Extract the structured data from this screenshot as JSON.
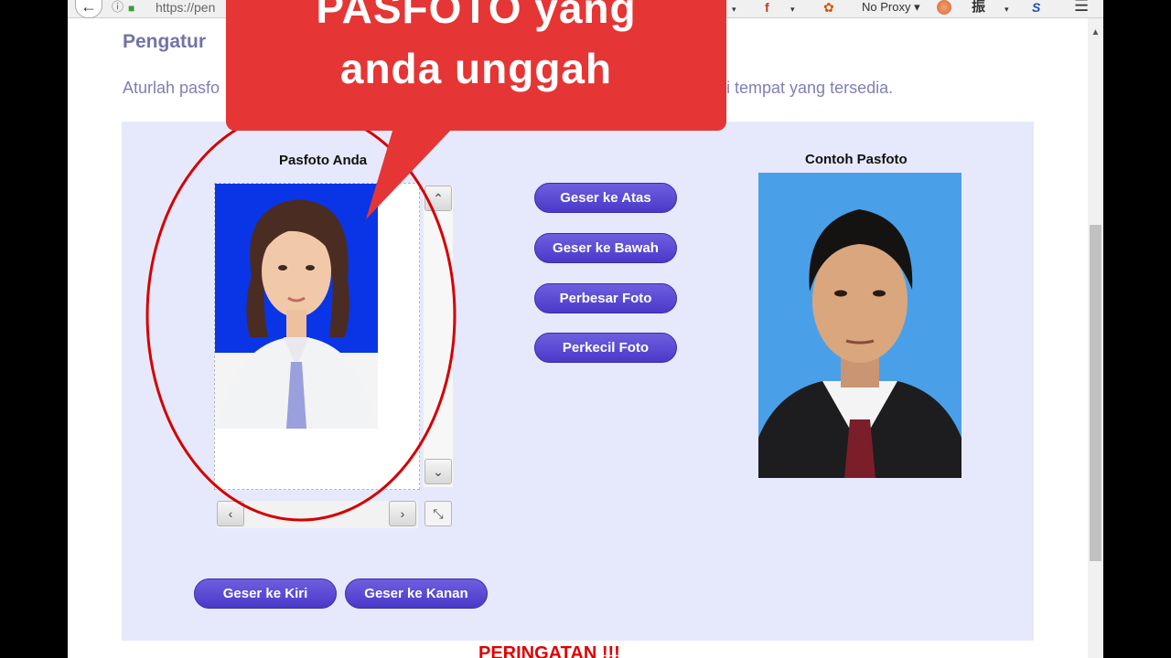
{
  "browser": {
    "url": "https://pen",
    "proxy_label": "No Proxy",
    "back_glyph": "←",
    "info_glyph": "ⓘ",
    "lock_glyph": "🔒",
    "dropdown_glyph": "▾",
    "font_glyph": "f",
    "fox_glyph": "🦊",
    "kanji_glyph": "振",
    "sj_glyph": "S",
    "menu_glyph": "☰",
    "scroll_up_glyph": "▲"
  },
  "page": {
    "heading": "Pengatur",
    "instruction_start": "Aturlah pasfo",
    "instruction_end": "i tempat yang tersedia.",
    "your_photo_caption": "Pasfoto Anda",
    "sample_photo_caption": "Contoh Pasfoto",
    "warning": "PERINGATAN !!!",
    "controls": {
      "up_glyph": "⌃",
      "down_glyph": "⌄",
      "left_glyph": "‹",
      "right_glyph": "›",
      "resize_glyph": "⤡"
    },
    "buttons": {
      "move_up": "Geser ke Atas",
      "move_down": "Geser ke Bawah",
      "zoom_in": "Perbesar Foto",
      "zoom_out": "Perkecil Foto",
      "move_left": "Geser ke Kiri",
      "move_right": "Geser ke Kanan"
    }
  },
  "annotation": {
    "line1": "PASFOTO yang",
    "line2": "anda unggah",
    "callout_color": "#e53535",
    "highlight_color": "#d40000"
  },
  "colors": {
    "button_primary": "#5a4ad4",
    "panel_bg": "#e6e9fb",
    "photo_bg_user": "#0a35e6",
    "photo_bg_sample": "#4aa0e8"
  }
}
